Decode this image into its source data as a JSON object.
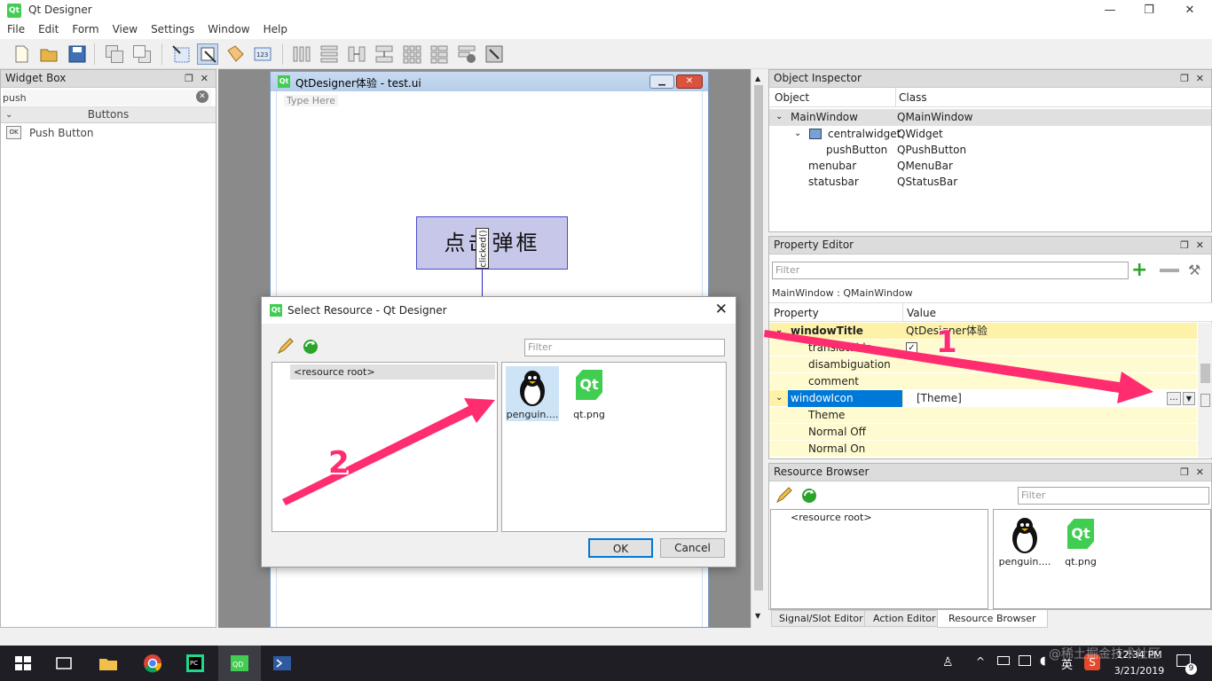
{
  "app": {
    "title": "Qt Designer",
    "icon_text": "Qt"
  },
  "window_controls": {
    "minimize": "—",
    "restore": "❐",
    "close": "✕"
  },
  "menu": [
    "File",
    "Edit",
    "Form",
    "View",
    "Settings",
    "Window",
    "Help"
  ],
  "widget_box": {
    "title": "Widget Box",
    "search_value": "push",
    "category": "Buttons",
    "items": [
      {
        "label": "Push Button",
        "icon_text": "OK"
      }
    ]
  },
  "form": {
    "title": "QtDesigner体验 - test.ui",
    "menu_placeholder": "Type Here",
    "button_text": "点击弹框",
    "signal_label": "clicked()"
  },
  "dialog": {
    "title": "Select Resource - Qt Designer",
    "filter_placeholder": "Filter",
    "tree_root": "<resource root>",
    "files": [
      {
        "name": "penguin....",
        "icon": "penguin-icon"
      },
      {
        "name": "qt.png",
        "icon": "qt-logo-icon"
      }
    ],
    "ok_label": "OK",
    "cancel_label": "Cancel"
  },
  "object_inspector": {
    "title": "Object Inspector",
    "col_object": "Object",
    "col_class": "Class",
    "rows": [
      {
        "object": "MainWindow",
        "class": "QMainWindow"
      },
      {
        "object": "centralwidget",
        "class": "QWidget"
      },
      {
        "object": "pushButton",
        "class": "QPushButton"
      },
      {
        "object": "menubar",
        "class": "QMenuBar"
      },
      {
        "object": "statusbar",
        "class": "QStatusBar"
      }
    ]
  },
  "property_editor": {
    "title": "Property Editor",
    "filter_placeholder": "Filter",
    "context": "MainWindow : QMainWindow",
    "col_property": "Property",
    "col_value": "Value",
    "rows": [
      {
        "name": "windowTitle",
        "value": "QtDesigner体验"
      },
      {
        "name": "translatable",
        "value": ""
      },
      {
        "name": "disambiguation",
        "value": ""
      },
      {
        "name": "comment",
        "value": ""
      },
      {
        "name": "windowIcon",
        "value": "[Theme]"
      },
      {
        "name": "Theme",
        "value": ""
      },
      {
        "name": "Normal Off",
        "value": ""
      },
      {
        "name": "Normal On",
        "value": ""
      }
    ],
    "ellipsis_label": "..."
  },
  "resource_browser": {
    "title": "Resource Browser",
    "filter_placeholder": "Filter",
    "tree_root": "<resource root>",
    "files": [
      {
        "name": "penguin...."
      },
      {
        "name": "qt.png"
      }
    ]
  },
  "bottom_tabs": [
    "Signal/Slot Editor",
    "Action Editor",
    "Resource Browser"
  ],
  "annotations": {
    "arrow1": "1",
    "arrow2": "2"
  },
  "taskbar": {
    "time": "12:34 PM",
    "date": "3/21/2019",
    "ime": "英",
    "notification_count": "9",
    "watermark": "@稀土掘金技术社区"
  },
  "colors": {
    "accent_highlight": "#0078d7",
    "property_yellow": "#fffbd0",
    "arrow": "#ff2d6f",
    "button_fill": "#c7c7ea"
  }
}
